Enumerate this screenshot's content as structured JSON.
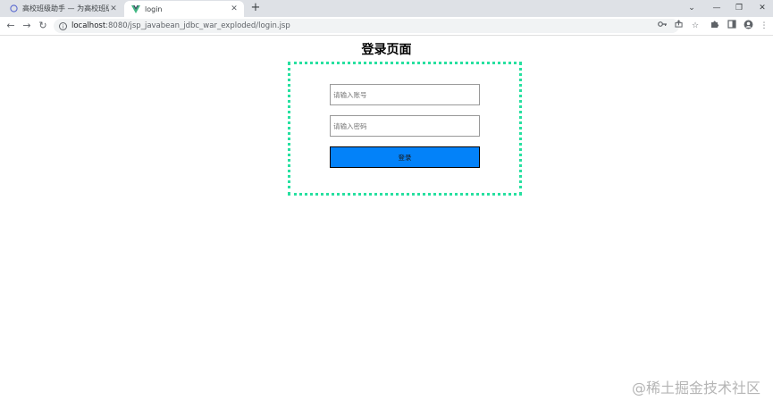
{
  "tabs": [
    {
      "title": "高校班级助手 — 为高校班级管理…",
      "active": false
    },
    {
      "title": "login",
      "active": true
    }
  ],
  "tab_close_glyph": "✕",
  "new_tab_glyph": "+",
  "window_controls": [
    "⌄",
    "—",
    "❐",
    "✕"
  ],
  "toolbar": {
    "back_glyph": "←",
    "forward_glyph": "→",
    "reload_glyph": "↻",
    "url_host": "localhost",
    "url_path": ":8080/jsp_javabean_jdbc_war_exploded/login.jsp"
  },
  "page": {
    "title": "登录页面",
    "username_placeholder": "请输入账号",
    "password_placeholder": "请输入密码",
    "submit_label": "登录"
  },
  "watermark": "@稀土掘金技术社区",
  "colors": {
    "accent_border": "#27e0a0",
    "button_bg": "#0382f9",
    "tab_strip": "#dee1e6"
  }
}
